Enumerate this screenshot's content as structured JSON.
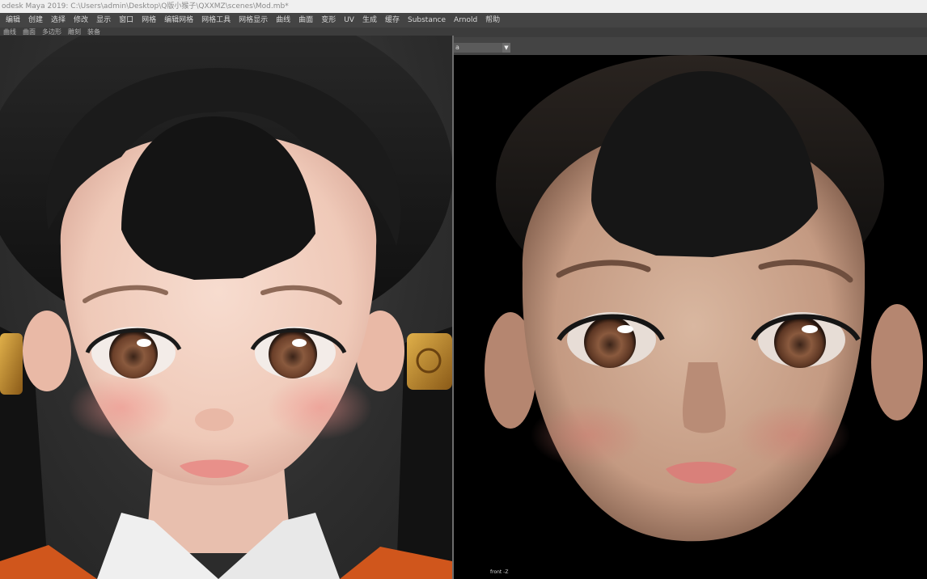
{
  "window": {
    "title": "odesk Maya 2019: C:\\Users\\admin\\Desktop\\Q版小猴子\\QXXMZ\\scenes\\Mod.mb*"
  },
  "menu": {
    "items": [
      "编辑",
      "创建",
      "选择",
      "修改",
      "显示",
      "窗口",
      "网格",
      "编辑网格",
      "网格工具",
      "网格显示",
      "曲线",
      "曲面",
      "变形",
      "UV",
      "生成",
      "缓存",
      "Substance",
      "Arnold",
      "帮助"
    ]
  },
  "shelf": {
    "items": [
      "曲线",
      "曲面",
      "多边形",
      "雕刻",
      "装备"
    ]
  },
  "viewport": {
    "camera_selected": "a",
    "view_label": "front -Z"
  },
  "colors": {
    "ui_dark": "#444444",
    "title_bg": "#f0f0f0",
    "viewport_bg": "#000000",
    "hair": "#151515",
    "skin_ref": "#f2d3c6",
    "skin_model": "#c9a48c",
    "iris": "#8a5a3e",
    "lip": "#e8908a",
    "gold": "#c09030",
    "collar": "#efefef",
    "robe": "#d0561c"
  },
  "icons": {
    "dropdown": "chevron-down-icon"
  }
}
